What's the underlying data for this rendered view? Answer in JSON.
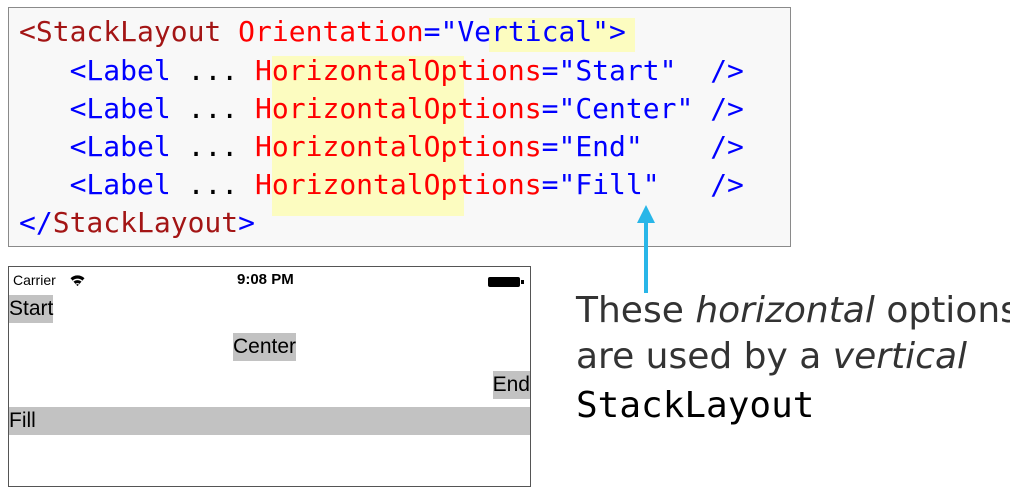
{
  "code": {
    "open_tag": "<StackLayout",
    "orientation_attr": "Orientation",
    "eq": "=",
    "quote": "\"",
    "orientation_value": "Vertical",
    "open_close": ">",
    "indent": "   ",
    "label_tag": "<Label",
    "ellipsis": " ... ",
    "horizontal_attr": "HorizontalOptions",
    "self_close": "/>",
    "lines": [
      {
        "value": "Start",
        "pad": "  "
      },
      {
        "value": "Center",
        "pad": " "
      },
      {
        "value": "End",
        "pad": "    "
      },
      {
        "value": "Fill",
        "pad": "   "
      }
    ],
    "close_tag_open": "</",
    "close_tag_name": "StackLayout",
    "close_tag_end": ">"
  },
  "phone": {
    "status_bar": {
      "carrier": "Carrier",
      "time": "9:08 PM"
    },
    "labels": {
      "start": "Start",
      "center": "Center",
      "end": "End",
      "fill": "Fill"
    }
  },
  "caption": {
    "line1_prefix": "These ",
    "line1_em": "horizontal",
    "line1_suffix": " options",
    "line2_prefix": "are used by a ",
    "line2_em": "vertical",
    "line3": "StackLayout"
  },
  "colors": {
    "tag": "#a31515",
    "attribute": "#ff0000",
    "value": "#0000ff",
    "highlight": "#fcfcc0",
    "arrow": "#29b6e8",
    "label_background": "#c2c2c2"
  },
  "icons": [
    "wifi-icon",
    "battery-icon",
    "arrow-up-icon"
  ]
}
